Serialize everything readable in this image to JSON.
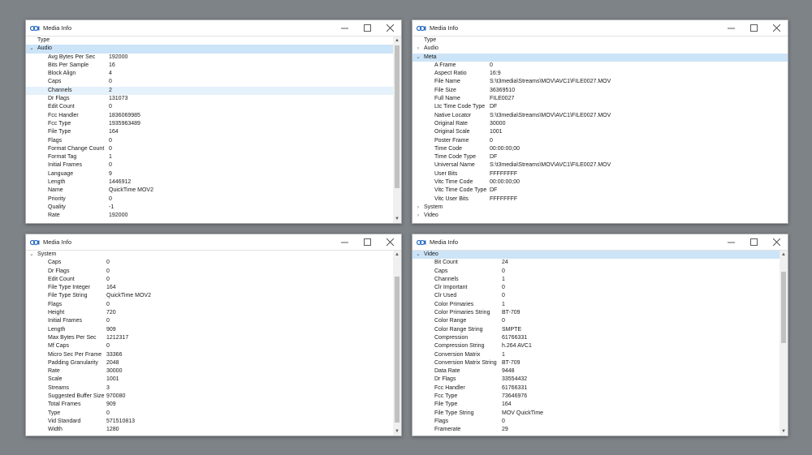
{
  "windows": [
    {
      "title": "Media Info",
      "rows": [
        {
          "type": "header",
          "name": "Type"
        },
        {
          "type": "group",
          "name": "Audio",
          "expanded": true,
          "selected": true
        },
        {
          "type": "prop",
          "name": "Avg Bytes Per Sec",
          "value": "192000"
        },
        {
          "type": "prop",
          "name": "Bits Per Sample",
          "value": "16"
        },
        {
          "type": "prop",
          "name": "Block Align",
          "value": "4"
        },
        {
          "type": "prop",
          "name": "Caps",
          "value": "0"
        },
        {
          "type": "prop",
          "name": "Channels",
          "value": "2",
          "highlighted": true
        },
        {
          "type": "prop",
          "name": "Dr Flags",
          "value": "131073"
        },
        {
          "type": "prop",
          "name": "Edit Count",
          "value": "0"
        },
        {
          "type": "prop",
          "name": "Fcc Handler",
          "value": "1836069985"
        },
        {
          "type": "prop",
          "name": "Fcc Type",
          "value": "1935963489"
        },
        {
          "type": "prop",
          "name": "File Type",
          "value": "164"
        },
        {
          "type": "prop",
          "name": "Flags",
          "value": "0"
        },
        {
          "type": "prop",
          "name": "Format Change Count",
          "value": "0"
        },
        {
          "type": "prop",
          "name": "Format Tag",
          "value": "1"
        },
        {
          "type": "prop",
          "name": "Initial Frames",
          "value": "0"
        },
        {
          "type": "prop",
          "name": "Language",
          "value": "9"
        },
        {
          "type": "prop",
          "name": "Length",
          "value": "1446912"
        },
        {
          "type": "prop",
          "name": "Name",
          "value": "QuickTime MOV2"
        },
        {
          "type": "prop",
          "name": "Priority",
          "value": "0"
        },
        {
          "type": "prop",
          "name": "Quality",
          "value": "-1"
        },
        {
          "type": "prop",
          "name": "Rate",
          "value": "192000"
        }
      ]
    },
    {
      "title": "Media Info",
      "rows": [
        {
          "type": "header",
          "name": "Type"
        },
        {
          "type": "group",
          "name": "Audio",
          "expanded": false
        },
        {
          "type": "group",
          "name": "Meta",
          "expanded": true,
          "selected": true
        },
        {
          "type": "prop",
          "name": "A Frame",
          "value": "0"
        },
        {
          "type": "prop",
          "name": "Aspect Ratio",
          "value": "16:9"
        },
        {
          "type": "prop",
          "name": "File Name",
          "value": "S:\\t3media\\Streams\\MOV\\AVC1\\FILE0027.MOV"
        },
        {
          "type": "prop",
          "name": "File Size",
          "value": "36369510"
        },
        {
          "type": "prop",
          "name": "Full Name",
          "value": "FILE0027"
        },
        {
          "type": "prop",
          "name": "Ltc Time Code Type",
          "value": "DF"
        },
        {
          "type": "prop",
          "name": "Native Locator",
          "value": "S:\\t3media\\Streams\\MOV\\AVC1\\FILE0027.MOV"
        },
        {
          "type": "prop",
          "name": "Original Rate",
          "value": "30000"
        },
        {
          "type": "prop",
          "name": "Original Scale",
          "value": "1001"
        },
        {
          "type": "prop",
          "name": "Poster Frame",
          "value": "0"
        },
        {
          "type": "prop",
          "name": "Time Code",
          "value": "00:00:00;00"
        },
        {
          "type": "prop",
          "name": "Time Code Type",
          "value": "DF"
        },
        {
          "type": "prop",
          "name": "Universal Name",
          "value": "S:\\t3media\\Streams\\MOV\\AVC1\\FILE0027.MOV"
        },
        {
          "type": "prop",
          "name": "User Bits",
          "value": "FFFFFFFF"
        },
        {
          "type": "prop",
          "name": "Vitc Time Code",
          "value": "00:00:00;00"
        },
        {
          "type": "prop",
          "name": "Vitc Time Code Type",
          "value": "DF"
        },
        {
          "type": "prop",
          "name": "Vitc User Bits",
          "value": "FFFFFFFF"
        },
        {
          "type": "group",
          "name": "System",
          "expanded": false
        },
        {
          "type": "group",
          "name": "Video",
          "expanded": false
        }
      ]
    },
    {
      "title": "Media Info",
      "rows": [
        {
          "type": "group",
          "name": "System",
          "expanded": true
        },
        {
          "type": "prop",
          "name": "Caps",
          "value": "0"
        },
        {
          "type": "prop",
          "name": "Dr Flags",
          "value": "0"
        },
        {
          "type": "prop",
          "name": "Edit Count",
          "value": "0"
        },
        {
          "type": "prop",
          "name": "File Type Integer",
          "value": "164"
        },
        {
          "type": "prop",
          "name": "File Type String",
          "value": "QuickTime MOV2"
        },
        {
          "type": "prop",
          "name": "Flags",
          "value": "0"
        },
        {
          "type": "prop",
          "name": "Height",
          "value": "720"
        },
        {
          "type": "prop",
          "name": "Initial Frames",
          "value": "0"
        },
        {
          "type": "prop",
          "name": "Length",
          "value": "909"
        },
        {
          "type": "prop",
          "name": "Max Bytes Per Sec",
          "value": "1212317"
        },
        {
          "type": "prop",
          "name": "Mf Caps",
          "value": "0"
        },
        {
          "type": "prop",
          "name": "Micro Sec Per Frame",
          "value": "33366"
        },
        {
          "type": "prop",
          "name": "Padding Granularity",
          "value": "2048"
        },
        {
          "type": "prop",
          "name": "Rate",
          "value": "30000"
        },
        {
          "type": "prop",
          "name": "Scale",
          "value": "1001"
        },
        {
          "type": "prop",
          "name": "Streams",
          "value": "3"
        },
        {
          "type": "prop",
          "name": "Suggested Buffer Size",
          "value": "970080"
        },
        {
          "type": "prop",
          "name": "Total Frames",
          "value": "909"
        },
        {
          "type": "prop",
          "name": "Type",
          "value": "0"
        },
        {
          "type": "prop",
          "name": "Vid Standard",
          "value": "571510813"
        },
        {
          "type": "prop",
          "name": "Width",
          "value": "1280"
        }
      ]
    },
    {
      "title": "Media Info",
      "rows": [
        {
          "type": "group",
          "name": "Video",
          "expanded": true,
          "selected": true
        },
        {
          "type": "prop",
          "name": "Bit Count",
          "value": "24"
        },
        {
          "type": "prop",
          "name": "Caps",
          "value": "0"
        },
        {
          "type": "prop",
          "name": "Channels",
          "value": "1"
        },
        {
          "type": "prop",
          "name": "Clr Important",
          "value": "0"
        },
        {
          "type": "prop",
          "name": "Clr Used",
          "value": "0"
        },
        {
          "type": "prop",
          "name": "Color Primaries",
          "value": "1"
        },
        {
          "type": "prop",
          "name": "Color Primaries String",
          "value": "BT-709"
        },
        {
          "type": "prop",
          "name": "Color Range",
          "value": "0"
        },
        {
          "type": "prop",
          "name": "Color Range String",
          "value": "SMPTE"
        },
        {
          "type": "prop",
          "name": "Compression",
          "value": "61766331"
        },
        {
          "type": "prop",
          "name": "Compression String",
          "value": "h.264 AVC1"
        },
        {
          "type": "prop",
          "name": "Conversion Matrix",
          "value": "1"
        },
        {
          "type": "prop",
          "name": "Conversion Matrix String",
          "value": "BT-709"
        },
        {
          "type": "prop",
          "name": "Data Rate",
          "value": "9448"
        },
        {
          "type": "prop",
          "name": "Dr Flags",
          "value": "33554432"
        },
        {
          "type": "prop",
          "name": "Fcc Handler",
          "value": "61766331"
        },
        {
          "type": "prop",
          "name": "Fcc Type",
          "value": "73646976"
        },
        {
          "type": "prop",
          "name": "File Type",
          "value": "164"
        },
        {
          "type": "prop",
          "name": "File Type String",
          "value": "MOV QuickTime"
        },
        {
          "type": "prop",
          "name": "Flags",
          "value": "0"
        },
        {
          "type": "prop",
          "name": "Framerate",
          "value": "29"
        }
      ]
    }
  ]
}
